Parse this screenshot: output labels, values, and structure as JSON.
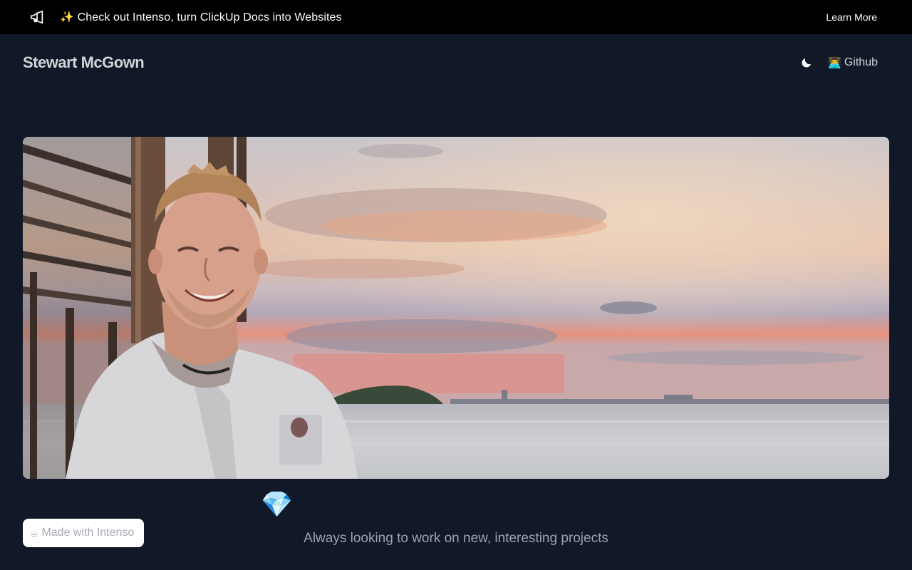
{
  "announcement": {
    "icon": "megaphone-icon",
    "message": "✨ Check out Intenso, turn ClickUp Docs into Websites",
    "cta": "Learn More"
  },
  "header": {
    "brand": "Stewart McGown",
    "theme_icon": "moon-icon",
    "github_emoji": "👨‍💻",
    "github_label": "Github"
  },
  "hero": {
    "description": "Photo of a smiling man at a waterfront at sunset"
  },
  "content": {
    "emoji": "💎",
    "tagline": "Always looking to work on new, interesting projects"
  },
  "badge": {
    "emoji": "☕",
    "label": "Made with Intenso"
  },
  "colors": {
    "background": "#111827",
    "announcement_bg": "#000000",
    "text_primary": "#d1d5db",
    "text_muted": "#9ca3af"
  }
}
